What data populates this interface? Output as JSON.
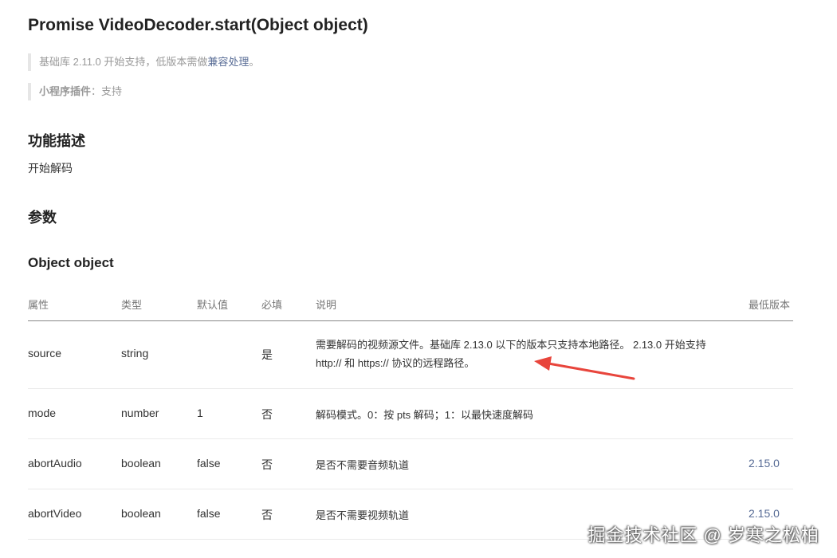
{
  "title": "Promise VideoDecoder.start(Object object)",
  "notes": {
    "lib_prefix": "基础库 2.11.0 开始支持，低版本需做",
    "lib_link": "兼容处理",
    "lib_suffix": "。",
    "plugin_label": "小程序插件",
    "plugin_value": "：支持"
  },
  "sections": {
    "func_title": "功能描述",
    "func_desc": "开始解码",
    "params_title": "参数",
    "object_title": "Object object"
  },
  "table": {
    "headers": [
      "属性",
      "类型",
      "默认值",
      "必填",
      "说明",
      "最低版本"
    ],
    "rows": [
      {
        "name": "source",
        "type": "string",
        "default": "",
        "required": "是",
        "desc": "需要解码的视频源文件。基础库 2.13.0 以下的版本只支持本地路径。 2.13.0 开始支持 http:// 和 https:// 协议的远程路径。",
        "version": ""
      },
      {
        "name": "mode",
        "type": "number",
        "default": "1",
        "required": "否",
        "desc": "解码模式。0：按 pts 解码；1：以最快速度解码",
        "version": ""
      },
      {
        "name": "abortAudio",
        "type": "boolean",
        "default": "false",
        "required": "否",
        "desc": "是否不需要音频轨道",
        "version": "2.15.0"
      },
      {
        "name": "abortVideo",
        "type": "boolean",
        "default": "false",
        "required": "否",
        "desc": "是否不需要视频轨道",
        "version": "2.15.0"
      }
    ]
  },
  "annotation_color": "#e8453c",
  "watermark": "掘金技术社区 @ 岁寒之松柏"
}
